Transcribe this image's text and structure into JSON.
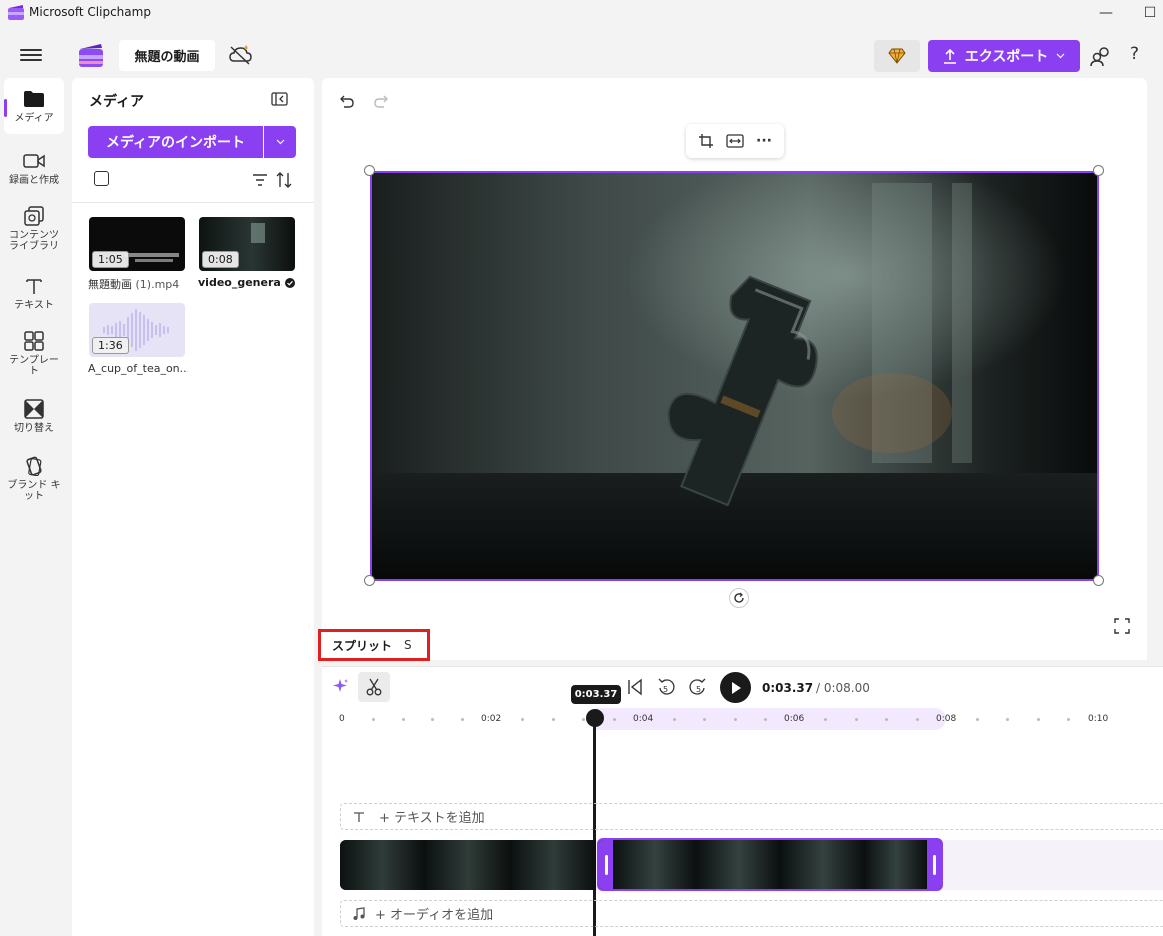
{
  "window": {
    "title": "Microsoft Clipchamp",
    "minimize_glyph": "—",
    "maximize_glyph": "☐"
  },
  "topbar": {
    "project_name": "無題の動画",
    "export_label": "エクスポート",
    "help_glyph": "?",
    "icons": [
      "menu-icon",
      "clipchamp-logo",
      "cloud-off-icon",
      "premium-diamond-icon",
      "share-people-icon",
      "help-icon"
    ]
  },
  "nav": {
    "items": [
      {
        "label": "メディア",
        "icon": "folder-icon",
        "active": true
      },
      {
        "label": "録画と作成",
        "icon": "camera-icon"
      },
      {
        "label": "コンテンツ ライブラリ",
        "icon": "library-icon"
      },
      {
        "label": "テキスト",
        "icon": "text-icon"
      },
      {
        "label": "テンプレー ト",
        "icon": "templates-icon"
      },
      {
        "label": "切り替え",
        "icon": "transitions-icon"
      },
      {
        "label": "ブランド キット",
        "icon": "brand-kit-icon"
      }
    ]
  },
  "media_panel": {
    "title": "メディア",
    "import_label": "メディアのインポート",
    "assets": [
      {
        "name": "無題動画",
        "suffix": "(1).mp4",
        "duration": "1:05"
      },
      {
        "name": "video_genera...",
        "suffix": "",
        "duration": "0:08"
      },
      {
        "name": "A_cup_of_tea_on...",
        "suffix": "",
        "duration": "1:36"
      }
    ]
  },
  "preview": {
    "toolbar": [
      "crop-icon",
      "fit-icon",
      "more-icon"
    ],
    "more_glyph": "···"
  },
  "split_tooltip": {
    "label": "スプリット",
    "shortcut": "S"
  },
  "timeline": {
    "current_time": "0:03.37",
    "total_time": "/ 0:08.00",
    "playhead_label": "0:03.37",
    "skip_back_seconds": "5",
    "skip_forward_seconds": "5",
    "ruler_labels": [
      "0",
      "0:02",
      "0:04",
      "0:06",
      "0:08",
      "0:10"
    ],
    "text_track_label": "+ テキストを追加",
    "audio_track_label": "+ オーディオを追加",
    "accent_color": "#8a3ff0"
  }
}
